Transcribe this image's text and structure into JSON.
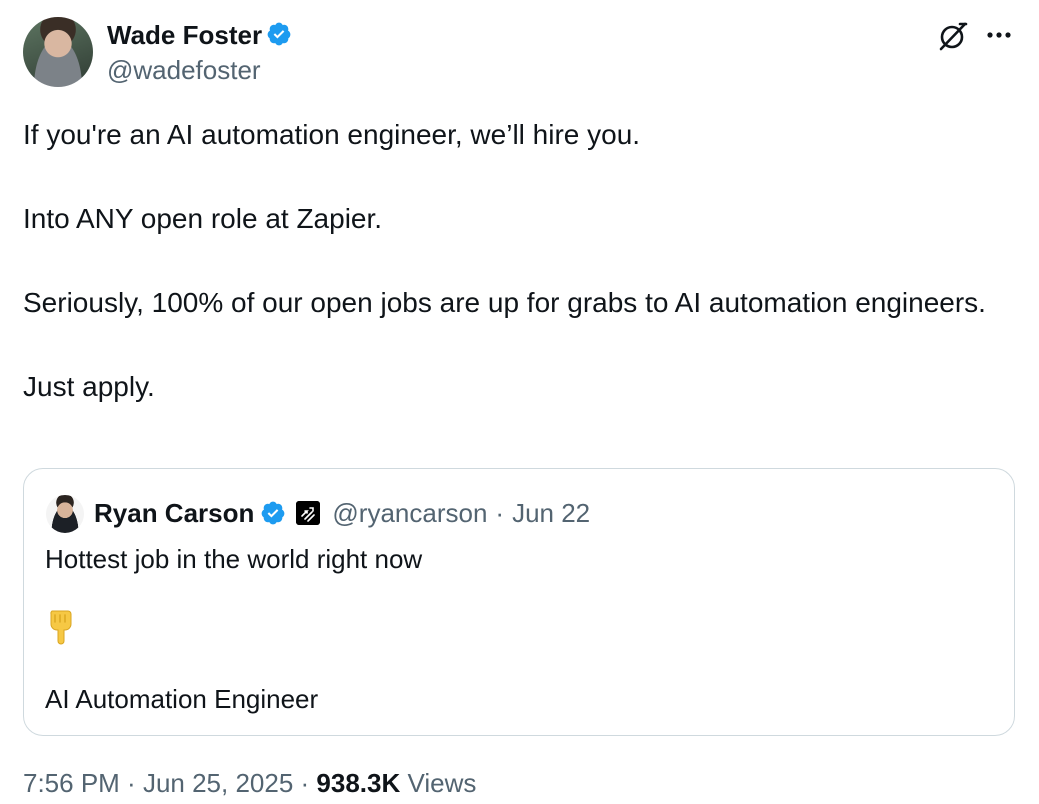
{
  "author": {
    "name": "Wade Foster",
    "handle": "@wadefoster",
    "verified": true
  },
  "icons": {
    "verified": "verified-badge-icon",
    "grok": "grok-icon",
    "more": "more-horizontal-icon",
    "affiliate": "affiliate-badge-icon",
    "emoji": "backhand-index-pointing-down-icon"
  },
  "colors": {
    "verified_blue": "#1d9bf0",
    "text_primary": "#0f1419",
    "text_secondary": "#536471",
    "border": "#cfd9de"
  },
  "tweet": {
    "paragraphs": [
      "If you're an AI automation engineer, we’ll hire you.",
      "Into ANY open role at Zapier.",
      "Seriously, 100% of our open jobs are up for grabs to AI automation engineers.",
      "Just apply."
    ]
  },
  "quote": {
    "name": "Ryan Carson",
    "handle": "@ryancarson",
    "separator": "·",
    "date": "Jun 22",
    "line1": "Hottest job in the world right now",
    "line2": "AI Automation Engineer"
  },
  "meta": {
    "time": "7:56 PM",
    "separator1": " · ",
    "date": "Jun 25, 2025",
    "separator2": " · ",
    "views_count": "938.3K",
    "views_label": " Views"
  }
}
